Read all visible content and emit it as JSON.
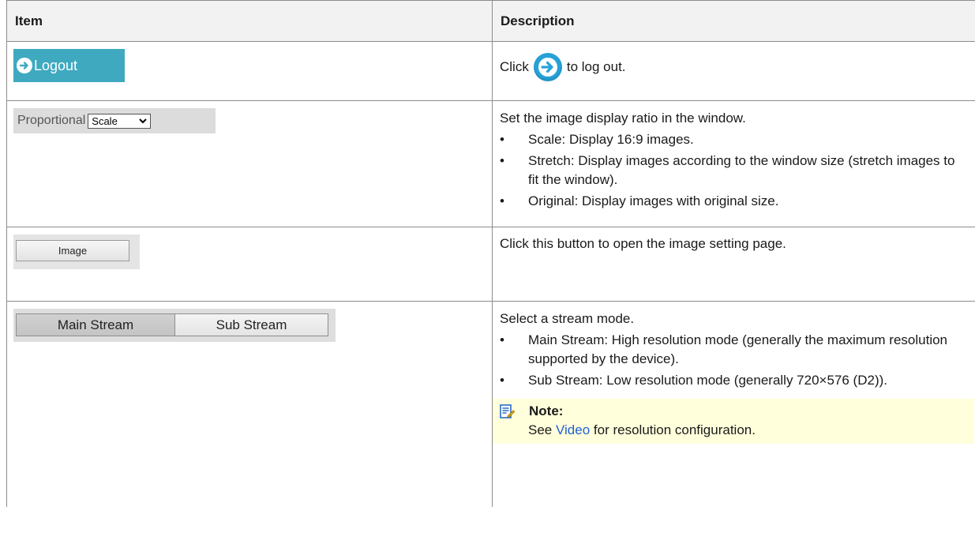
{
  "table": {
    "headers": {
      "item": "Item",
      "description": "Description"
    },
    "logout": {
      "button_label": "Logout",
      "click_prefix": "Click",
      "click_suffix": "to log out."
    },
    "proportional": {
      "label": "Proportional",
      "select_value": "Scale",
      "intro": "Set the image display ratio in the window.",
      "bullets": [
        "Scale: Display 16:9 images.",
        "Stretch: Display images according to the window size (stretch images to fit the window).",
        "Original: Display images with original size."
      ]
    },
    "image": {
      "button_label": "Image",
      "description": "Click this button to open the image setting page."
    },
    "stream": {
      "main_label": "Main Stream",
      "sub_label": "Sub Stream",
      "intro": "Select a stream mode.",
      "bullets": [
        "Main Stream: High resolution mode (generally the maximum resolution supported by the device).",
        "Sub Stream: Low resolution mode (generally 720×576 (D2))."
      ],
      "note": {
        "title": "Note:",
        "prefix": "See",
        "link": "Video",
        "suffix": "for resolution configuration."
      }
    }
  }
}
